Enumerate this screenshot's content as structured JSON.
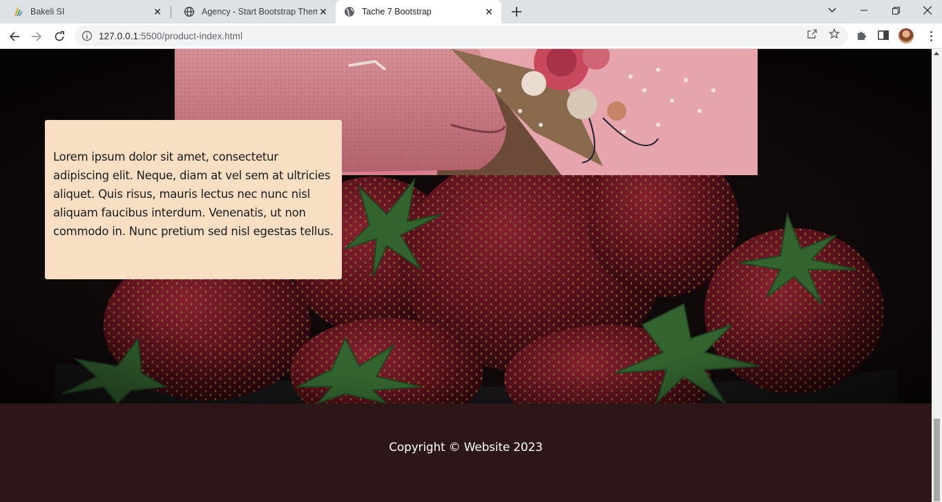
{
  "browser": {
    "tabs": [
      {
        "title": "Bakeli SI",
        "favicon": "bakeli-logo-icon",
        "active": false
      },
      {
        "title": "Agency - Start Bootstrap Theme",
        "favicon": "globe-icon",
        "active": false
      },
      {
        "title": "Tache 7 Bootstrap",
        "favicon": "globe-icon",
        "active": true
      }
    ],
    "url_host": "127.0.0.1",
    "url_path": ":5500/product-index.html"
  },
  "page": {
    "card_text": "Lorem ipsum dolor sit amet, consectetur adipiscing elit. Neque, diam at vel sem at ultricies aliquet. Quis risus, mauris lectus nec nunc nisl aliquam faucibus interdum. Venenatis, ut non commodo in. Nunc pretium sed nisl egestas tellus.",
    "footer_text": "Copyright © Website 2023"
  },
  "colors": {
    "card_background": "#f8dfc3",
    "footer_background": "#2d1617",
    "page_background": "#140c0d"
  }
}
